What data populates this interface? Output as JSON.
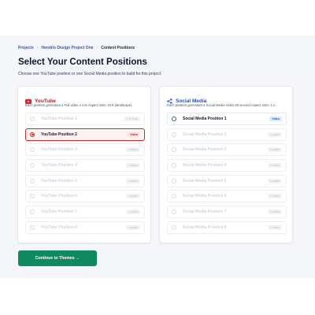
{
  "breadcrumb": {
    "root": "Projects",
    "project": "Hendrix Design Project One",
    "current": "Content Positions",
    "sep": "›"
  },
  "page": {
    "title": "Select Your Content Positions",
    "subtitle": "Choose one YouTube position or one Social Media position to build for this project."
  },
  "youtube": {
    "title": "YouTube",
    "color": "#dc2626",
    "description": "Each position generates a Full video 4 min Aspect ratio: 16:9 (landscape).",
    "rows": [
      {
        "label": "YouTube Position 1",
        "badge": "1 To Spin",
        "state": "disabled"
      },
      {
        "label": "YouTube Position 2",
        "badge": "Video",
        "state": "selected"
      },
      {
        "label": "YouTube Position 3",
        "badge": "Locked",
        "state": "disabled"
      },
      {
        "label": "YouTube Position 4",
        "badge": "Locked",
        "state": "disabled"
      },
      {
        "label": "YouTube Position 5",
        "badge": "Locked",
        "state": "disabled"
      },
      {
        "label": "YouTube Position 6",
        "badge": "Locked",
        "state": "disabled"
      },
      {
        "label": "YouTube Position 7",
        "badge": "Locked",
        "state": "disabled"
      },
      {
        "label": "YouTube Position 8",
        "badge": "Locked",
        "state": "disabled"
      }
    ]
  },
  "social": {
    "title": "Social Media",
    "color": "#1d4ed8",
    "description": "Each position generates a Social Media Video 60 second Aspect ratio: 1:1.",
    "rows": [
      {
        "label": "Social Media Position 1",
        "badge": "Video",
        "state": "active"
      },
      {
        "label": "Social Media Position 2",
        "badge": "Locked",
        "state": "disabled"
      },
      {
        "label": "Social Media Position 3",
        "badge": "Locked",
        "state": "disabled"
      },
      {
        "label": "Social Media Position 4",
        "badge": "Locked",
        "state": "disabled"
      },
      {
        "label": "Social Media Position 5",
        "badge": "Locked",
        "state": "disabled"
      },
      {
        "label": "Social Media Position 6",
        "badge": "Locked",
        "state": "disabled"
      },
      {
        "label": "Social Media Position 7",
        "badge": "Locked",
        "state": "disabled"
      },
      {
        "label": "Social Media Position 8",
        "badge": "Locked",
        "state": "disabled"
      }
    ]
  },
  "cta": {
    "label": "Continue to Themes →",
    "color": "#0f8a5f"
  },
  "icons": {
    "youtube": "youtube-icon",
    "social": "share-icon"
  }
}
